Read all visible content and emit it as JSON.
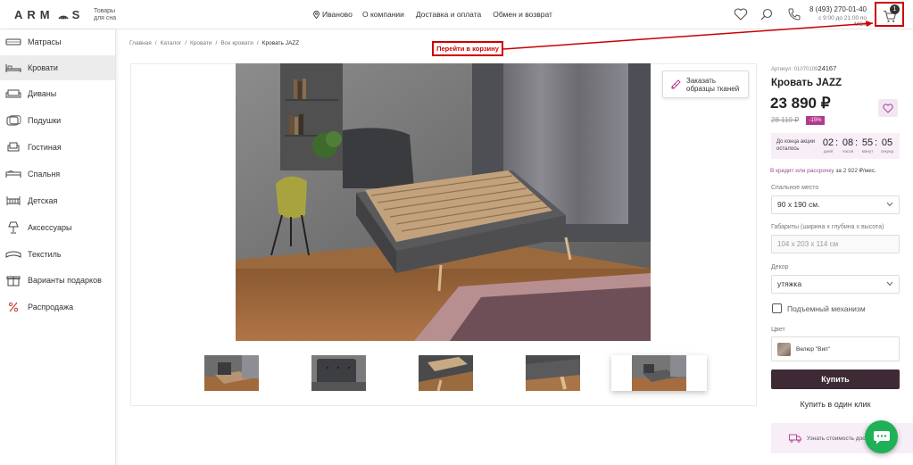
{
  "header": {
    "logo_left": "ARM",
    "logo_right": "S",
    "tagline_line1": "Товары",
    "tagline_line2": "для сна",
    "city": "Иваново",
    "nav": [
      "О компании",
      "Доставка и оплата",
      "Обмен и возврат"
    ],
    "phone": "8 (493) 270-01-40",
    "hours": "с 9:00 до 21:00 по МСК",
    "cart_count": "1"
  },
  "annotation": {
    "label": "Перейти в корзину",
    "color": "#cc0000"
  },
  "sidebar": {
    "items": [
      {
        "label": "Матрасы",
        "icon": "mattress-icon"
      },
      {
        "label": "Кровати",
        "icon": "bed-icon",
        "active": true
      },
      {
        "label": "Диваны",
        "icon": "sofa-icon"
      },
      {
        "label": "Подушки",
        "icon": "pillow-icon"
      },
      {
        "label": "Гостиная",
        "icon": "armchair-icon"
      },
      {
        "label": "Спальня",
        "icon": "bedroom-icon"
      },
      {
        "label": "Детская",
        "icon": "crib-icon"
      },
      {
        "label": "Аксессуары",
        "icon": "lamp-icon"
      },
      {
        "label": "Текстиль",
        "icon": "textile-icon"
      },
      {
        "label": "Варианты подарков",
        "icon": "gift-icon"
      },
      {
        "label": "Распродажа",
        "icon": "percent-icon"
      }
    ]
  },
  "breadcrumb": [
    "Главная",
    "Каталог",
    "Кровати",
    "Все кровати",
    "Кровать JAZZ"
  ],
  "gallery": {
    "fabric_button_line1": "Заказать",
    "fabric_button_line2": "образцы тканей",
    "thumb_count": 5
  },
  "product": {
    "sku_label": "Артикул: 01070109",
    "sku_code": "24167",
    "title": "Кровать JAZZ",
    "price": "23 890 ₽",
    "old_price": "28 110 ₽",
    "discount": "-15%",
    "timer_label_line1": "До конца акции",
    "timer_label_line2": "осталось",
    "timer": [
      {
        "value": "02",
        "unit": "дней"
      },
      {
        "value": "08",
        "unit": "часов"
      },
      {
        "value": "55",
        "unit": "минут"
      },
      {
        "value": "05",
        "unit": "секунд"
      }
    ],
    "credit_link": "В кредит или рассрочку",
    "credit_text": " за 2 922 ₽/мес.",
    "sleep_place_label": "Спальное место",
    "sleep_place_value": "90 x 190 см.",
    "dimensions_label": "Габариты (ширина x глубина x высота)",
    "dimensions_value": "104 x 203 x 114 см",
    "decor_label": "Декор",
    "decor_value": "утяжка",
    "lift_label": "Подъемный механизм",
    "color_label": "Цвет",
    "color_value": "Велюр \"Вип\"",
    "buy_label": "Купить",
    "oneclick_label": "Купить в один клик",
    "delivery_label": "Узнать стоимость доставки"
  },
  "colors": {
    "accent": "#9c4a92",
    "discount": "#b33b8e",
    "buy": "#3d2a35",
    "chat": "#1fb155",
    "annotation": "#cc0000"
  }
}
